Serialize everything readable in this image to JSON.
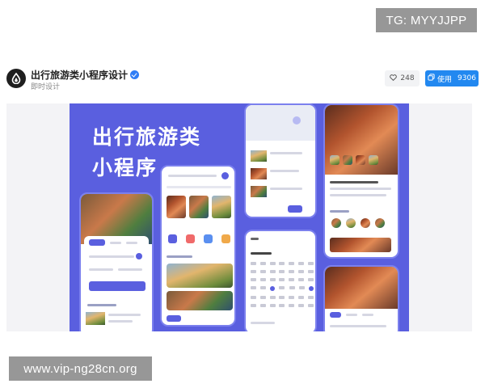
{
  "header": {
    "title": "出行旅游类小程序设计",
    "subtitle": "即时设计",
    "like_count": "248",
    "use_label": "使用",
    "use_count": "9306"
  },
  "banner": {
    "headline_line1": "出行旅游类",
    "headline_line2": "小程序",
    "accent_color": "#5a5fdf"
  },
  "watermarks": {
    "top": "TG: MYYJJPP",
    "bottom": "www.vip-ng28cn.org"
  },
  "icons": [
    "logo-icon",
    "verified-icon",
    "heart-icon",
    "copy-icon"
  ]
}
